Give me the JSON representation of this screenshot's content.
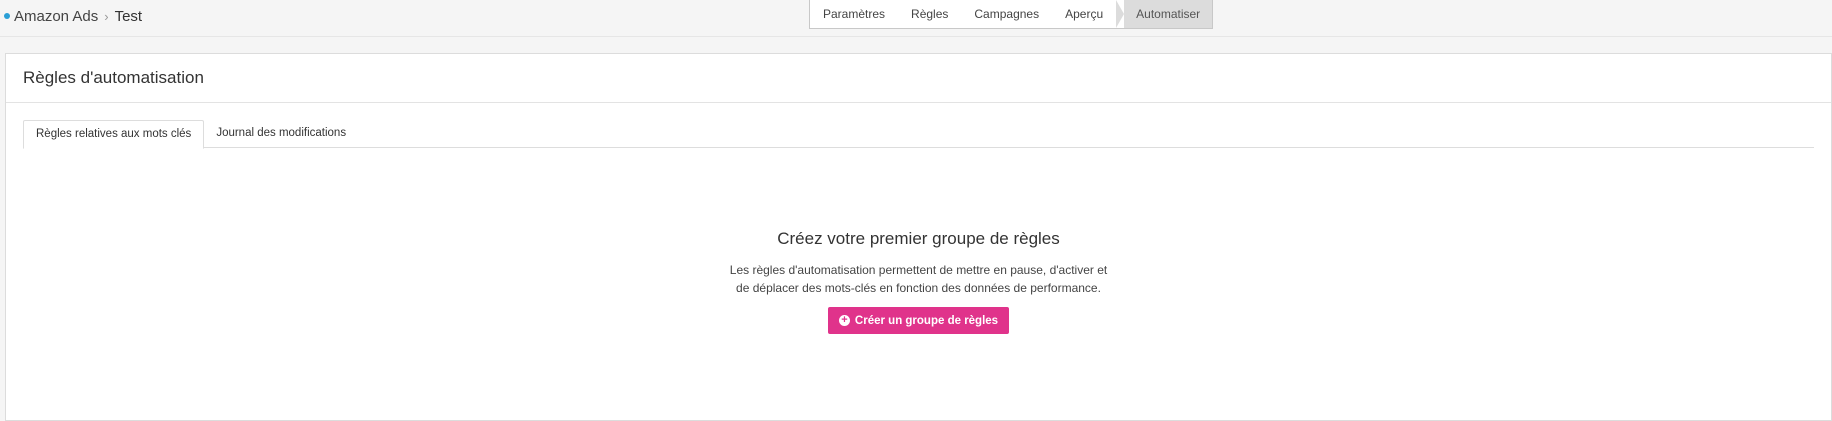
{
  "breadcrumb": {
    "root": "Amazon Ads",
    "current": "Test"
  },
  "steps": [
    {
      "label": "Paramètres",
      "active": false
    },
    {
      "label": "Règles",
      "active": false
    },
    {
      "label": "Campagnes",
      "active": false
    },
    {
      "label": "Aperçu",
      "active": false
    },
    {
      "label": "Automatiser",
      "active": true
    }
  ],
  "panel": {
    "title": "Règles d'automatisation",
    "tabs": [
      {
        "label": "Règles relatives aux mots clés",
        "active": true
      },
      {
        "label": "Journal des modifications",
        "active": false
      }
    ]
  },
  "empty_state": {
    "heading": "Créez votre premier groupe de règles",
    "line1": "Les règles d'automatisation permettent de mettre en pause, d'activer et",
    "line2": "de déplacer des mots-clés en fonction des données de performance.",
    "button_label": "Créer un groupe de règles"
  },
  "colors": {
    "accent": "#e0338b",
    "dot": "#2a9fd6"
  }
}
